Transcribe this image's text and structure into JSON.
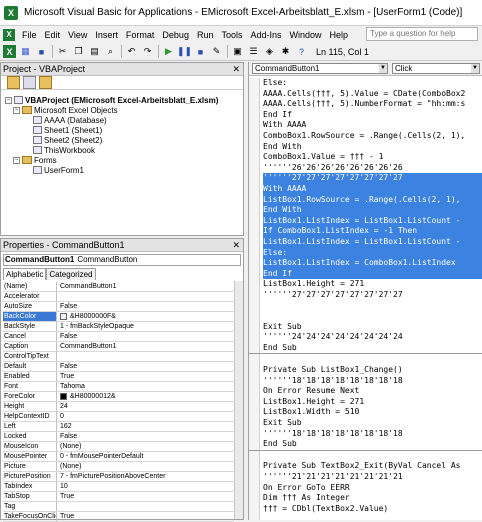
{
  "window": {
    "title": "Microsoft Visual Basic for Applications - EMicrosoft Excel-Arbeitsblatt_E.xlsm - [UserForm1 (Code)]",
    "app_icon": "X"
  },
  "menu": {
    "items": [
      "File",
      "Edit",
      "View",
      "Insert",
      "Format",
      "Debug",
      "Run",
      "Tools",
      "Add-Ins",
      "Window",
      "Help"
    ],
    "help_placeholder": "Type a question for help"
  },
  "toolbar": {
    "position": "Ln 115, Col 1"
  },
  "project": {
    "title": "Project - VBAProject",
    "root": "VBAProject (EMicrosoft Excel-Arbeitsblatt_E.xlsm)",
    "excel_objects": "Microsoft Excel Objects",
    "sheets": [
      "AAAA (Database)",
      "Sheet1 (Sheet1)",
      "Sheet2 (Sheet2)",
      "ThisWorkbook"
    ],
    "forms": "Forms",
    "userform": "UserForm1"
  },
  "properties": {
    "title": "Properties - CommandButton1",
    "combo_name": "CommandButton1",
    "combo_type": "CommandButton",
    "tab_alpha": "Alphabetic",
    "tab_cat": "Categorized",
    "rows": [
      {
        "name": "(Name)",
        "value": "CommandButton1"
      },
      {
        "name": "Accelerator",
        "value": ""
      },
      {
        "name": "AutoSize",
        "value": "False"
      },
      {
        "name": "BackColor",
        "value": "&H8000000F&",
        "swatch": "#f0f0f0"
      },
      {
        "name": "BackStyle",
        "value": "1 - fmBackStyleOpaque"
      },
      {
        "name": "Cancel",
        "value": "False"
      },
      {
        "name": "Caption",
        "value": "CommandButton1"
      },
      {
        "name": "ControlTipText",
        "value": ""
      },
      {
        "name": "Default",
        "value": "False"
      },
      {
        "name": "Enabled",
        "value": "True"
      },
      {
        "name": "Font",
        "value": "Tahoma"
      },
      {
        "name": "ForeColor",
        "value": "&H80000012&",
        "swatch": "#000000"
      },
      {
        "name": "Height",
        "value": "24"
      },
      {
        "name": "HelpContextID",
        "value": "0"
      },
      {
        "name": "Left",
        "value": "162"
      },
      {
        "name": "Locked",
        "value": "False"
      },
      {
        "name": "MouseIcon",
        "value": "(None)"
      },
      {
        "name": "MousePointer",
        "value": "0 - fmMousePointerDefault"
      },
      {
        "name": "Picture",
        "value": "(None)"
      },
      {
        "name": "PicturePosition",
        "value": "7 - fmPicturePositionAboveCenter"
      },
      {
        "name": "TabIndex",
        "value": "10"
      },
      {
        "name": "TabStop",
        "value": "True"
      },
      {
        "name": "Tag",
        "value": ""
      },
      {
        "name": "TakeFocusOnClick",
        "value": "True"
      }
    ]
  },
  "code": {
    "object_combo": "CommandButton1",
    "proc_combo": "Click",
    "lines": [
      {
        "t": "Else:"
      },
      {
        "t": "AAAA.Cells(†††, 5).Value = CDate(ComboBox2"
      },
      {
        "t": "AAAA.Cells(†††, 5).NumberFormat = \"hh:mm:s"
      },
      {
        "t": "End If"
      },
      {
        "t": "With AAAA"
      },
      {
        "t": "ComboBox1.RowSource = .Range(.Cells(2, 1),"
      },
      {
        "t": "End With"
      },
      {
        "t": "ComboBox1.Value = ††† - 1"
      },
      {
        "t": "''''''26'26'26'26'26'26'26'26"
      },
      {
        "t": "''''''27'27'27'27'27'27'27'27",
        "hl": true
      },
      {
        "t": "With AAAA",
        "hl": true
      },
      {
        "t": "ListBox1.RowSource = .Range(.Cells(2, 1),",
        "hl": true
      },
      {
        "t": "End With",
        "hl": true
      },
      {
        "t": "ListBox1.ListIndex = ListBox1.ListCount -",
        "hl": true
      },
      {
        "t": "If ComboBox1.ListIndex = -1 Then",
        "hl": true
      },
      {
        "t": "ListBox1.ListIndex = ListBox1.ListCount -",
        "hl": true
      },
      {
        "t": "Else:",
        "hl": true
      },
      {
        "t": "ListBox1.ListIndex = ComboBox1.ListIndex",
        "hl": true
      },
      {
        "t": "End If",
        "hl": true
      },
      {
        "t": "ListBox1.Height = 271"
      },
      {
        "t": "''''''27'27'27'27'27'27'27'27"
      },
      {
        "t": ""
      },
      {
        "t": ""
      },
      {
        "t": "Exit Sub"
      },
      {
        "t": "''''''24'24'24'24'24'24'24'24"
      },
      {
        "t": "End Sub",
        "div": true
      },
      {
        "t": ""
      },
      {
        "t": "Private Sub ListBox1_Change()"
      },
      {
        "t": "''''''18'18'18'18'18'18'18'18"
      },
      {
        "t": "On Error Resume Next"
      },
      {
        "t": "ListBox1.Height = 271"
      },
      {
        "t": "ListBox1.Width = 510"
      },
      {
        "t": "Exit Sub"
      },
      {
        "t": "''''''18'18'18'18'18'18'18'18"
      },
      {
        "t": "End Sub",
        "div": true
      },
      {
        "t": ""
      },
      {
        "t": "Private Sub TextBox2_Exit(ByVal Cancel As"
      },
      {
        "t": "''''''21'21'21'21'21'21'21'21"
      },
      {
        "t": "On Error GoTo EERR"
      },
      {
        "t": "Dim ††† As Integer"
      },
      {
        "t": "††† = CDbl(TextBox2.Value)"
      }
    ]
  }
}
